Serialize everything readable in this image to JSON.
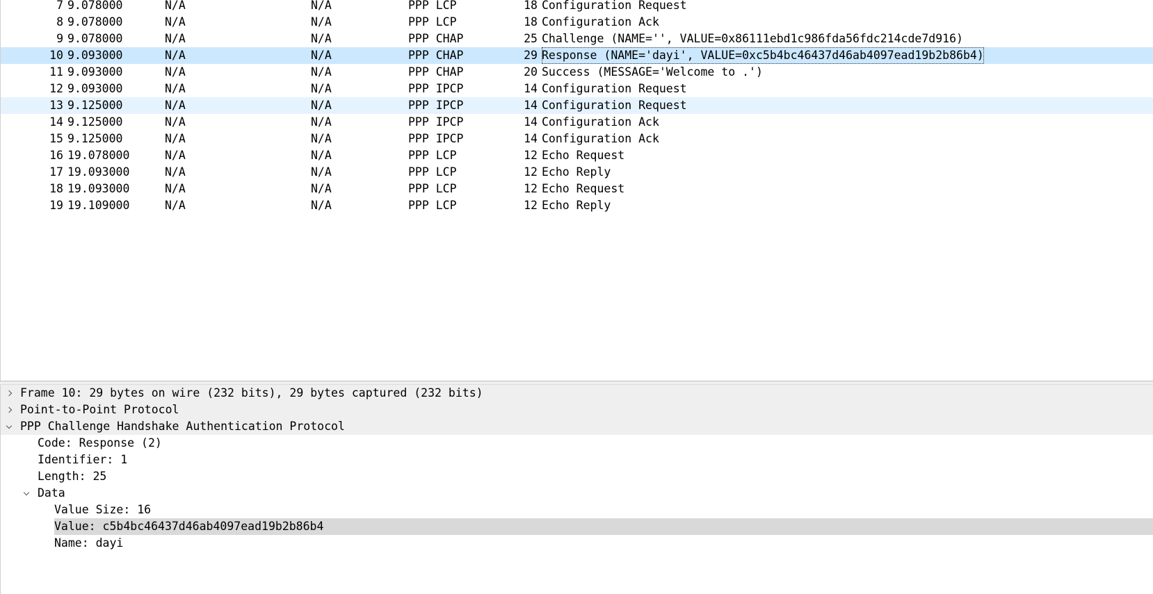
{
  "packet_list": {
    "rows": [
      {
        "no": "7",
        "time": "9.078000",
        "source": "N/A",
        "destination": "N/A",
        "protocol": "PPP LCP",
        "length": "18",
        "info": "Configuration Request"
      },
      {
        "no": "8",
        "time": "9.078000",
        "source": "N/A",
        "destination": "N/A",
        "protocol": "PPP LCP",
        "length": "18",
        "info": "Configuration Ack"
      },
      {
        "no": "9",
        "time": "9.078000",
        "source": "N/A",
        "destination": "N/A",
        "protocol": "PPP CHAP",
        "length": "25",
        "info": "Challenge (NAME='', VALUE=0x86111ebd1c986fda56fdc214cde7d916)"
      },
      {
        "no": "10",
        "time": "9.093000",
        "source": "N/A",
        "destination": "N/A",
        "protocol": "PPP CHAP",
        "length": "29",
        "info": "Response (NAME='dayi', VALUE=0xc5b4bc46437d46ab4097ead19b2b86b4)"
      },
      {
        "no": "11",
        "time": "9.093000",
        "source": "N/A",
        "destination": "N/A",
        "protocol": "PPP CHAP",
        "length": "20",
        "info": "Success (MESSAGE='Welcome to .')"
      },
      {
        "no": "12",
        "time": "9.093000",
        "source": "N/A",
        "destination": "N/A",
        "protocol": "PPP IPCP",
        "length": "14",
        "info": "Configuration Request"
      },
      {
        "no": "13",
        "time": "9.125000",
        "source": "N/A",
        "destination": "N/A",
        "protocol": "PPP IPCP",
        "length": "14",
        "info": "Configuration Request"
      },
      {
        "no": "14",
        "time": "9.125000",
        "source": "N/A",
        "destination": "N/A",
        "protocol": "PPP IPCP",
        "length": "14",
        "info": "Configuration Ack"
      },
      {
        "no": "15",
        "time": "9.125000",
        "source": "N/A",
        "destination": "N/A",
        "protocol": "PPP IPCP",
        "length": "14",
        "info": "Configuration Ack"
      },
      {
        "no": "16",
        "time": "19.078000",
        "source": "N/A",
        "destination": "N/A",
        "protocol": "PPP LCP",
        "length": "12",
        "info": "Echo Request"
      },
      {
        "no": "17",
        "time": "19.093000",
        "source": "N/A",
        "destination": "N/A",
        "protocol": "PPP LCP",
        "length": "12",
        "info": "Echo Reply"
      },
      {
        "no": "18",
        "time": "19.093000",
        "source": "N/A",
        "destination": "N/A",
        "protocol": "PPP LCP",
        "length": "12",
        "info": "Echo Request"
      },
      {
        "no": "19",
        "time": "19.109000",
        "source": "N/A",
        "destination": "N/A",
        "protocol": "PPP LCP",
        "length": "12",
        "info": "Echo Reply"
      }
    ],
    "selected_no": "10",
    "hover_no": "13"
  },
  "details": {
    "frame": "Frame 10: 29 bytes on wire (232 bits), 29 bytes captured (232 bits)",
    "ppp": "Point-to-Point Protocol",
    "chap": "PPP Challenge Handshake Authentication Protocol",
    "code": "Code: Response (2)",
    "identifier": "Identifier: 1",
    "length": "Length: 25",
    "data": "Data",
    "value_size": "Value Size: 16",
    "value": "Value: c5b4bc46437d46ab4097ead19b2b86b4",
    "name": "Name: dayi"
  },
  "colors": {
    "selected_row": "#cce8ff",
    "hover_row": "#e5f3ff",
    "selected_field": "#d9d9d9",
    "tree_header": "#efefef"
  },
  "icons": {
    "collapsed": "chevron-right-icon",
    "expanded": "chevron-down-icon"
  }
}
